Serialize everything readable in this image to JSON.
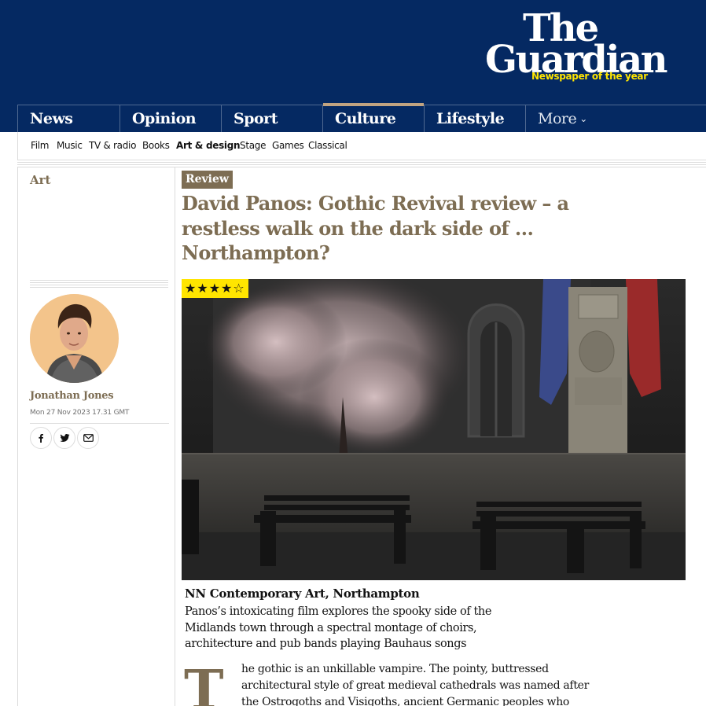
{
  "masthead": {
    "logo_line1": "The",
    "logo_line2": "Guardian",
    "tagline": "Newspaper of the year"
  },
  "pillars": [
    {
      "label": "News"
    },
    {
      "label": "Opinion"
    },
    {
      "label": "Sport"
    },
    {
      "label": "Culture",
      "active": true
    },
    {
      "label": "Lifestyle"
    },
    {
      "label": "More"
    }
  ],
  "subnav": [
    {
      "label": "Film"
    },
    {
      "label": "Music"
    },
    {
      "label": "TV & radio"
    },
    {
      "label": "Books"
    },
    {
      "label": "Art & design",
      "active": true
    },
    {
      "label": "Stage"
    },
    {
      "label": "Games"
    },
    {
      "label": "Classical"
    }
  ],
  "section": "Art",
  "author": {
    "name": "Jonathan Jones",
    "date": "Mon 27 Nov 2023 17.31 GMT"
  },
  "share_icons": [
    "facebook-icon",
    "twitter-icon",
    "email-icon"
  ],
  "article": {
    "kicker": "Review",
    "headline": "David Panos: Gothic Revival review – a restless walk on the dark side of … Northampton?",
    "rating": 4,
    "rating_max": 5,
    "rating_display": "★★★★☆",
    "venue": "NN Contemporary Art, Northampton",
    "standfirst": "Panos’s intoxicating film explores the spooky side of the Midlands town through a spectral montage of choirs, architecture and pub bands playing Bauhaus songs",
    "dropcap": "T",
    "body": "he gothic is an unkillable vampire. The pointy, buttressed\narchitectural style of great medieval cathedrals was named after\nthe Ostrogoths and Visigoths, ancient Germanic peoples who"
  },
  "colors": {
    "brand_blue": "#052962",
    "culture_accent": "#7d6d53",
    "culture_bar": "#c1a381",
    "star_bg": "#ffe500",
    "tagline_yellow": "#ffe500"
  }
}
